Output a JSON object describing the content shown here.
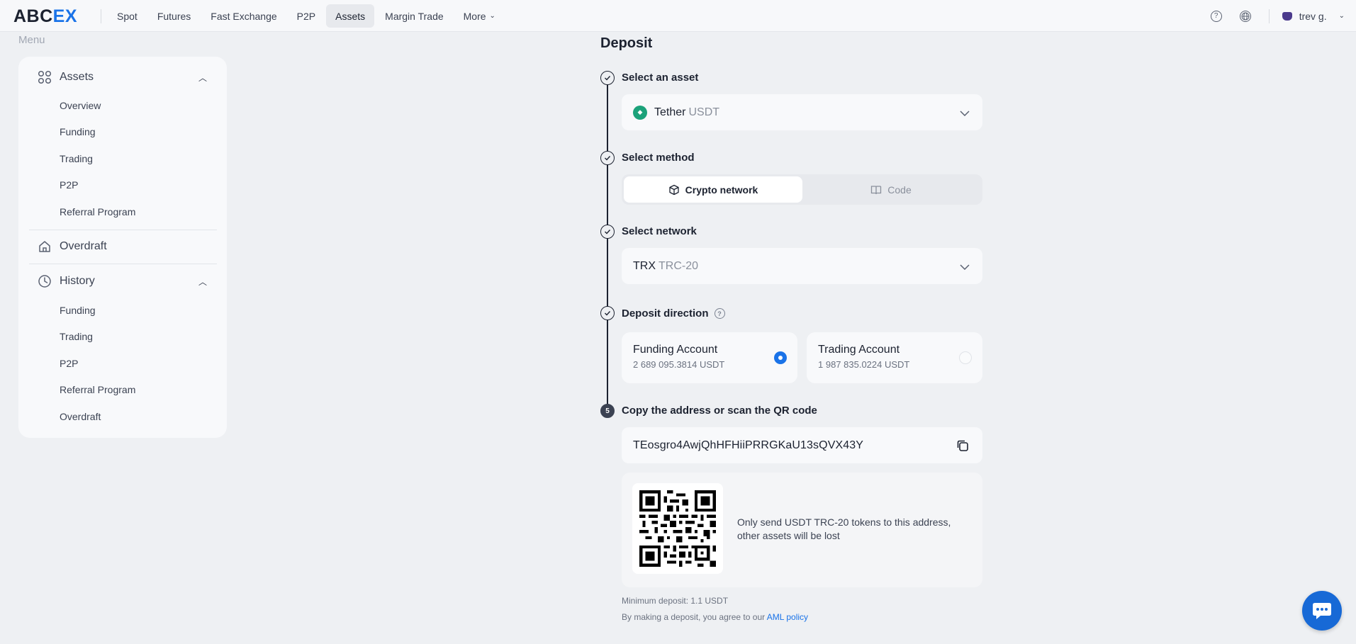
{
  "brand": {
    "logo_part1": "ABC",
    "logo_part2": "EX"
  },
  "nav": {
    "items": [
      "Spot",
      "Futures",
      "Fast Exchange",
      "P2P",
      "Assets",
      "Margin Trade",
      "More"
    ],
    "active": "Assets"
  },
  "topbar": {
    "user_name": "trev g.",
    "help_icon": "question-circle-icon",
    "lang_icon": "globe-icon"
  },
  "sidebar": {
    "menu_label": "Menu",
    "assets": {
      "label": "Assets",
      "items": [
        "Overview",
        "Funding",
        "Trading",
        "P2P",
        "Referral Program"
      ]
    },
    "overdraft": {
      "label": "Overdraft"
    },
    "history": {
      "label": "History",
      "items": [
        "Funding",
        "Trading",
        "P2P",
        "Referral Program",
        "Overdraft"
      ]
    }
  },
  "deposit": {
    "title": "Deposit",
    "step1": {
      "title": "Select an asset",
      "asset_name": "Tether",
      "asset_code": "USDT"
    },
    "step2": {
      "title": "Select method",
      "options": [
        "Crypto network",
        "Code"
      ],
      "selected": "Crypto network"
    },
    "step3": {
      "title": "Select network",
      "network_name": "TRX",
      "network_code": "TRC-20"
    },
    "step4": {
      "title": "Deposit direction",
      "accounts": [
        {
          "name": "Funding Account",
          "balance": "2 689 095.3814 USDT",
          "selected": true
        },
        {
          "name": "Trading Account",
          "balance": "1 987 835.0224 USDT",
          "selected": false
        }
      ]
    },
    "step5": {
      "number": "5",
      "title": "Copy the address or scan the QR code",
      "address": "TEosgro4AwjQhHFHiiPRRGKaU13sQVX43Y",
      "warning": "Only send USDT TRC-20 tokens to this address, other assets will be lost"
    },
    "min_deposit": "Minimum deposit: 1.1 USDT",
    "agree_text": "By making a deposit, you agree to our",
    "aml_link": "AML policy"
  },
  "colors": {
    "accent": "#1a73e8",
    "tether": "#1ba27a",
    "background": "#eef0f3"
  }
}
